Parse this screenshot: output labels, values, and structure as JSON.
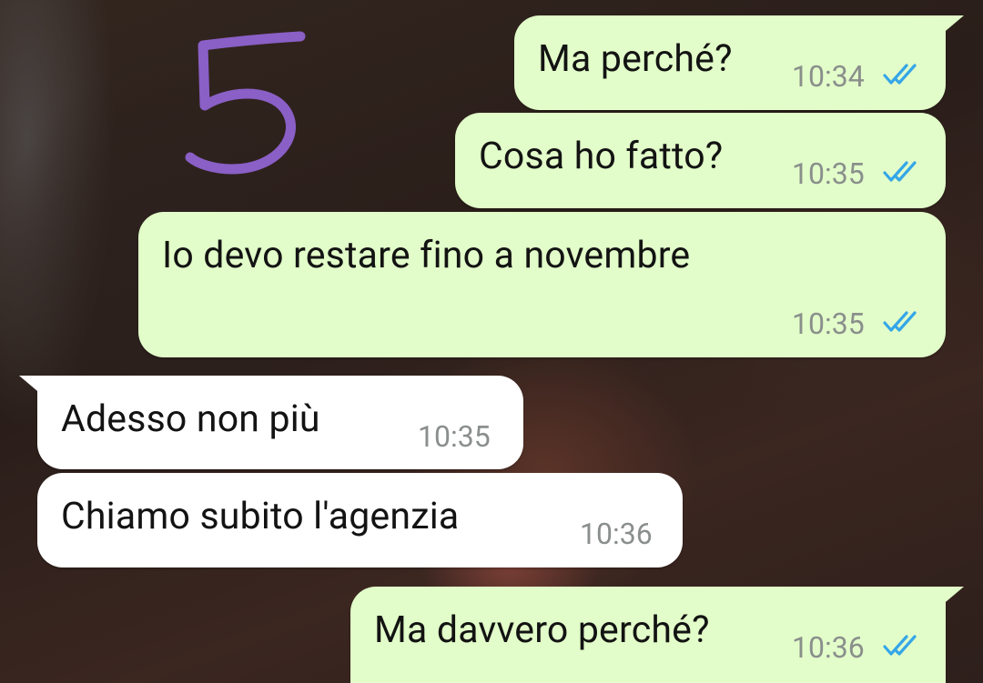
{
  "chat": {
    "annotation_number": "5",
    "messages": [
      {
        "direction": "outgoing",
        "text": "Ma perché?",
        "time": "10:34",
        "status": "read"
      },
      {
        "direction": "outgoing",
        "text": "Cosa ho fatto?",
        "time": "10:35",
        "status": "read"
      },
      {
        "direction": "outgoing",
        "text": "Io devo restare fino a novembre",
        "time": "10:35",
        "status": "read"
      },
      {
        "direction": "incoming",
        "text": "Adesso non più",
        "time": "10:35"
      },
      {
        "direction": "incoming",
        "text": "Chiamo subito l'agenzia",
        "time": "10:36"
      },
      {
        "direction": "outgoing",
        "text": "Ma davvero perché?",
        "time": "10:36",
        "status": "read"
      }
    ]
  },
  "colors": {
    "outgoing_bubble": "#e2fdc9",
    "incoming_bubble": "#ffffff",
    "read_ticks": "#35a6e8",
    "annotation_stroke": "#8a5fc6"
  },
  "icons": {
    "read_status": "double-check-icon",
    "annotation": "handwritten-number"
  }
}
